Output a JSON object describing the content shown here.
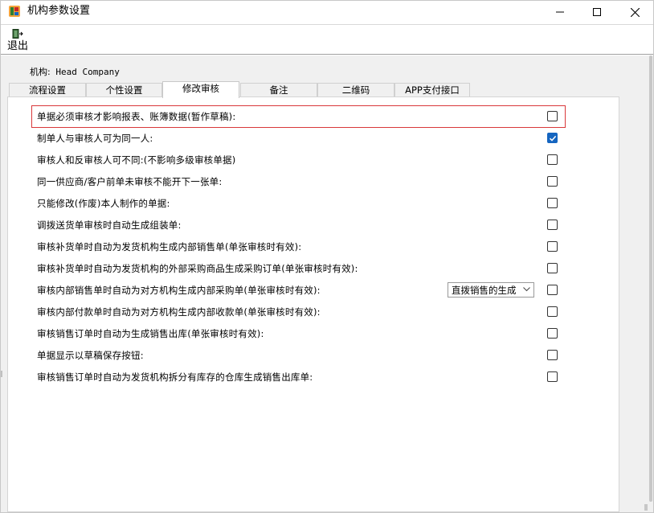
{
  "window": {
    "title": "机构参数设置",
    "controls": {
      "minimize": "minimize-icon",
      "maximize": "maximize-icon",
      "close": "close-icon"
    }
  },
  "toolbar": {
    "exit_label": "退出",
    "exit_icon": "exit-door-icon"
  },
  "org": {
    "label": "机构:",
    "value": "Head Company"
  },
  "tabs": [
    {
      "label": "流程设置",
      "active": false
    },
    {
      "label": "个性设置",
      "active": false
    },
    {
      "label": "修改审核",
      "active": true
    },
    {
      "label": "备注",
      "active": false
    },
    {
      "label": "二维码",
      "active": false
    },
    {
      "label": "APP支付接口",
      "active": false
    }
  ],
  "options": [
    {
      "label": "单据必须审核才影响报表、账簿数据(暂作草稿):",
      "checked": false,
      "highlighted": true
    },
    {
      "label": "制单人与审核人可为同一人:",
      "checked": true
    },
    {
      "label": "审核人和反审核人可不同:(不影响多级审核单据)",
      "checked": false
    },
    {
      "label": "同一供应商/客户前单未审核不能开下一张单:",
      "checked": false
    },
    {
      "label": "只能修改(作废)本人制作的单据:",
      "checked": false
    },
    {
      "label": "调拨送货单审核时自动生成组装单:",
      "checked": false
    },
    {
      "label": "审核补货单时自动为发货机构生成内部销售单(单张审核时有效):",
      "checked": false
    },
    {
      "label": "审核补货单时自动为发货机构的外部采购商品生成采购订单(单张审核时有效):",
      "checked": false
    },
    {
      "label": "审核内部销售单时自动为对方机构生成内部采购单(单张审核时有效):",
      "checked": false,
      "select": "直拨销售的生成"
    },
    {
      "label": "审核内部付款单时自动为对方机构生成内部收款单(单张审核时有效):",
      "checked": false
    },
    {
      "label": "审核销售订单时自动为生成销售出库(单张审核时有效):",
      "checked": false
    },
    {
      "label": "单据显示以草稿保存按钮:",
      "checked": false
    },
    {
      "label": "审核销售订单时自动为发货机构拆分有库存的仓库生成销售出库单:",
      "checked": false
    }
  ],
  "colors": {
    "accent": "#1565c0",
    "highlight_border": "#d9383a"
  }
}
